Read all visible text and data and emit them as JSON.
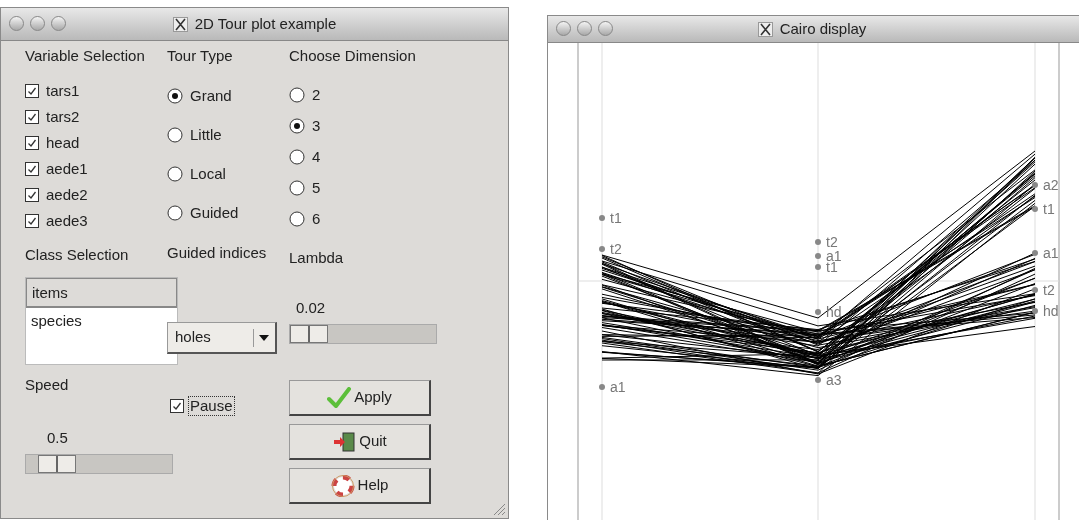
{
  "tour_window": {
    "title": "2D Tour plot example",
    "variable_selection": {
      "label": "Variable Selection",
      "items": [
        {
          "label": "tars1",
          "checked": true
        },
        {
          "label": "tars2",
          "checked": true
        },
        {
          "label": "head",
          "checked": true
        },
        {
          "label": "aede1",
          "checked": true
        },
        {
          "label": "aede2",
          "checked": true
        },
        {
          "label": "aede3",
          "checked": true
        }
      ]
    },
    "tour_type": {
      "label": "Tour Type",
      "options": [
        {
          "label": "Grand",
          "selected": true
        },
        {
          "label": "Little",
          "selected": false
        },
        {
          "label": "Local",
          "selected": false
        },
        {
          "label": "Guided",
          "selected": false
        }
      ]
    },
    "dimension": {
      "label": "Choose Dimension",
      "options": [
        {
          "label": "2",
          "selected": false
        },
        {
          "label": "3",
          "selected": true
        },
        {
          "label": "4",
          "selected": false
        },
        {
          "label": "5",
          "selected": false
        },
        {
          "label": "6",
          "selected": false
        }
      ]
    },
    "class_selection": {
      "label": "Class Selection",
      "header": "items",
      "items": [
        "species"
      ]
    },
    "guided_indices": {
      "label": "Guided indices",
      "value": "holes"
    },
    "lambda": {
      "label": "Lambda",
      "reading": "0.02",
      "level": 0
    },
    "speed": {
      "label": "Speed",
      "reading": "0.5",
      "level": 0.11
    },
    "pause": {
      "label": "Pause",
      "checked": true
    },
    "buttons": [
      {
        "label": "Apply",
        "kind": "apply"
      },
      {
        "label": "Quit",
        "kind": "quit"
      },
      {
        "label": "Help",
        "kind": "help"
      }
    ]
  },
  "cairo_window": {
    "title": "Cairo display",
    "axes": [
      {
        "labels": [
          "t1",
          "t2",
          "a1"
        ]
      },
      {
        "labels": [
          "t2",
          "a1",
          "t1",
          "hd",
          "a3"
        ]
      },
      {
        "labels": [
          "a2",
          "t1",
          "a1",
          "t2",
          "hd"
        ]
      }
    ]
  }
}
